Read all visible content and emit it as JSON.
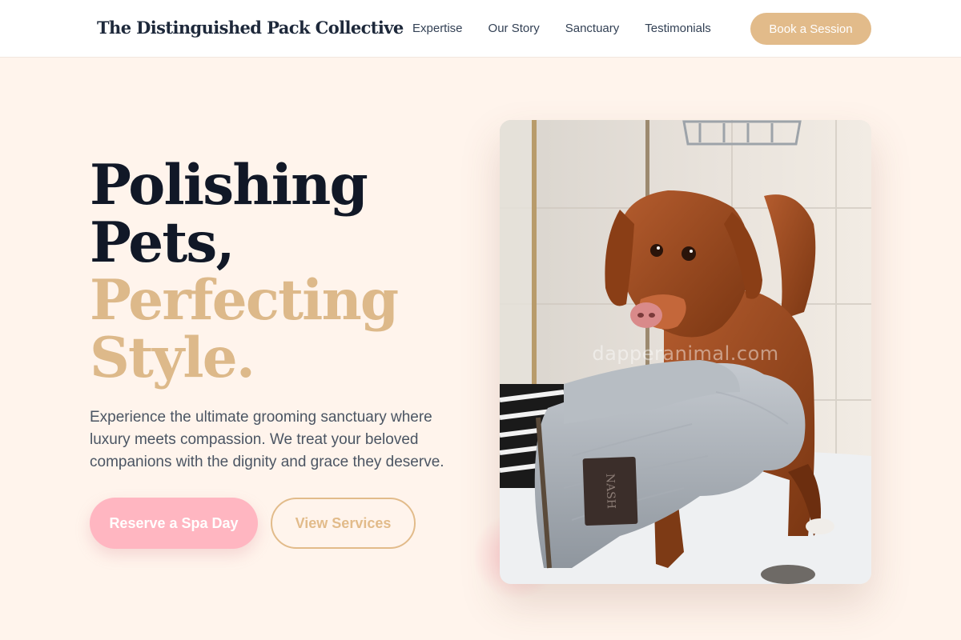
{
  "header": {
    "brand": "The Distinguished Pack Collective",
    "nav": [
      "Expertise",
      "Our Story",
      "Sanctuary",
      "Testimonials"
    ],
    "cta": "Book a Session"
  },
  "hero": {
    "headline_line1": "Polishing",
    "headline_line2": "Pets,",
    "headline_line3": "Perfecting",
    "headline_line4": "Style.",
    "description": "Experience the ultimate grooming sanctuary where luxury meets compassion. We treat your beloved companions with the dignity and grace they deserve.",
    "primary_button": "Reserve a Spa Day",
    "secondary_button": "View Services",
    "image_watermark": "dapperanimal.com"
  },
  "colors": {
    "background": "#fff4ec",
    "accent_gold": "#e2bb8a",
    "accent_pink": "#ffb6c1",
    "text_dark": "#111827"
  }
}
